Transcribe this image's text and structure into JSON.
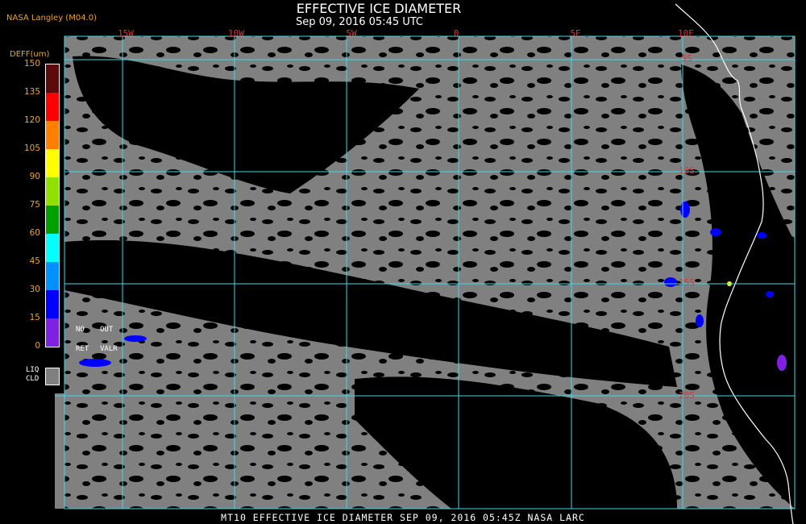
{
  "header": {
    "title": "EFFECTIVE ICE DIAMETER",
    "subtitle": "Sep 09, 2016 05:45 UTC",
    "credit": "NASA Langley (M04.0)"
  },
  "legend": {
    "title": "DEFF(um)",
    "ticks": [
      "150",
      "135",
      "120",
      "105",
      "90",
      "75",
      "60",
      "45",
      "30",
      "15",
      "0"
    ],
    "colors": [
      "#5a0a0a",
      "#ff0000",
      "#ff8000",
      "#ffff00",
      "#90e000",
      "#00a000",
      "#00ffff",
      "#0090ff",
      "#0000ff",
      "#8020e0"
    ],
    "no_ret": [
      "NO",
      "RET"
    ],
    "out_valr": [
      "OUT",
      "VALR"
    ],
    "liq_cld": [
      "LIQ",
      "CLD"
    ],
    "liq_color": "#808080"
  },
  "map": {
    "lon_labels": [
      "15W",
      "10W",
      "5W",
      "0",
      "5E",
      "10E"
    ],
    "lat_labels": [
      "5S",
      "10S",
      "15S",
      "20S"
    ],
    "grid_color": "#40d8e8",
    "label_color": "#d23a3a",
    "clear_color": "#000000",
    "cloud_color": "#808080",
    "coast_color": "#ffffff"
  },
  "footer": {
    "text": "MT10  EFFECTIVE ICE DIAMETER   SEP 09, 2016 05:45Z   NASA LARC"
  }
}
